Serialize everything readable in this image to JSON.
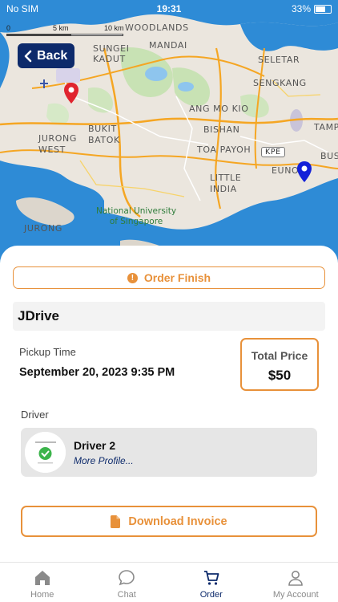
{
  "status_bar": {
    "carrier": "No SIM",
    "time": "19:31",
    "battery": "33%"
  },
  "map": {
    "scale_labels": [
      "0",
      "5 km",
      "10 km"
    ],
    "places": {
      "woodlands": "WOODLANDS",
      "mandai": "MANDAI",
      "sungei_kadut": "SUNGEI\nKADUT",
      "seletar": "SELETAR",
      "sengkang": "SENGKANG",
      "ang_mo_kio": "ANG MO KIO",
      "tampines": "TAMP",
      "bukit_batok": "BUKIT\nBATOK",
      "bishan": "BISHAN",
      "jurong_west": "JURONG\nWEST",
      "toa_payoh": "TOA PAYOH",
      "kpe": "KPE",
      "bus": "BUS",
      "eunos": "EUNOS",
      "little_india": "LITTLE\nINDIA",
      "nus": "National University\nof Singapore",
      "jurong": "JURONG"
    }
  },
  "back_button": {
    "label": "Back"
  },
  "order": {
    "status": "Order Finish",
    "service": "JDrive",
    "pickup_label": "Pickup Time",
    "pickup_time": "September 20, 2023 9:35 PM",
    "price_label": "Total Price",
    "price": "$50",
    "driver_label": "Driver",
    "driver_name": "Driver 2",
    "driver_link": "More Profile...",
    "invoice_button": "Download Invoice"
  },
  "colors": {
    "accent": "#e8913a",
    "primary": "#0d2a6b",
    "pickup_pin": "#e0242f",
    "dropoff_pin": "#1320d8"
  },
  "tabs": [
    {
      "label": "Home",
      "icon": "home-icon",
      "active": false
    },
    {
      "label": "Chat",
      "icon": "chat-icon",
      "active": false
    },
    {
      "label": "Order",
      "icon": "cart-icon",
      "active": true
    },
    {
      "label": "My Account",
      "icon": "user-icon",
      "active": false
    }
  ]
}
